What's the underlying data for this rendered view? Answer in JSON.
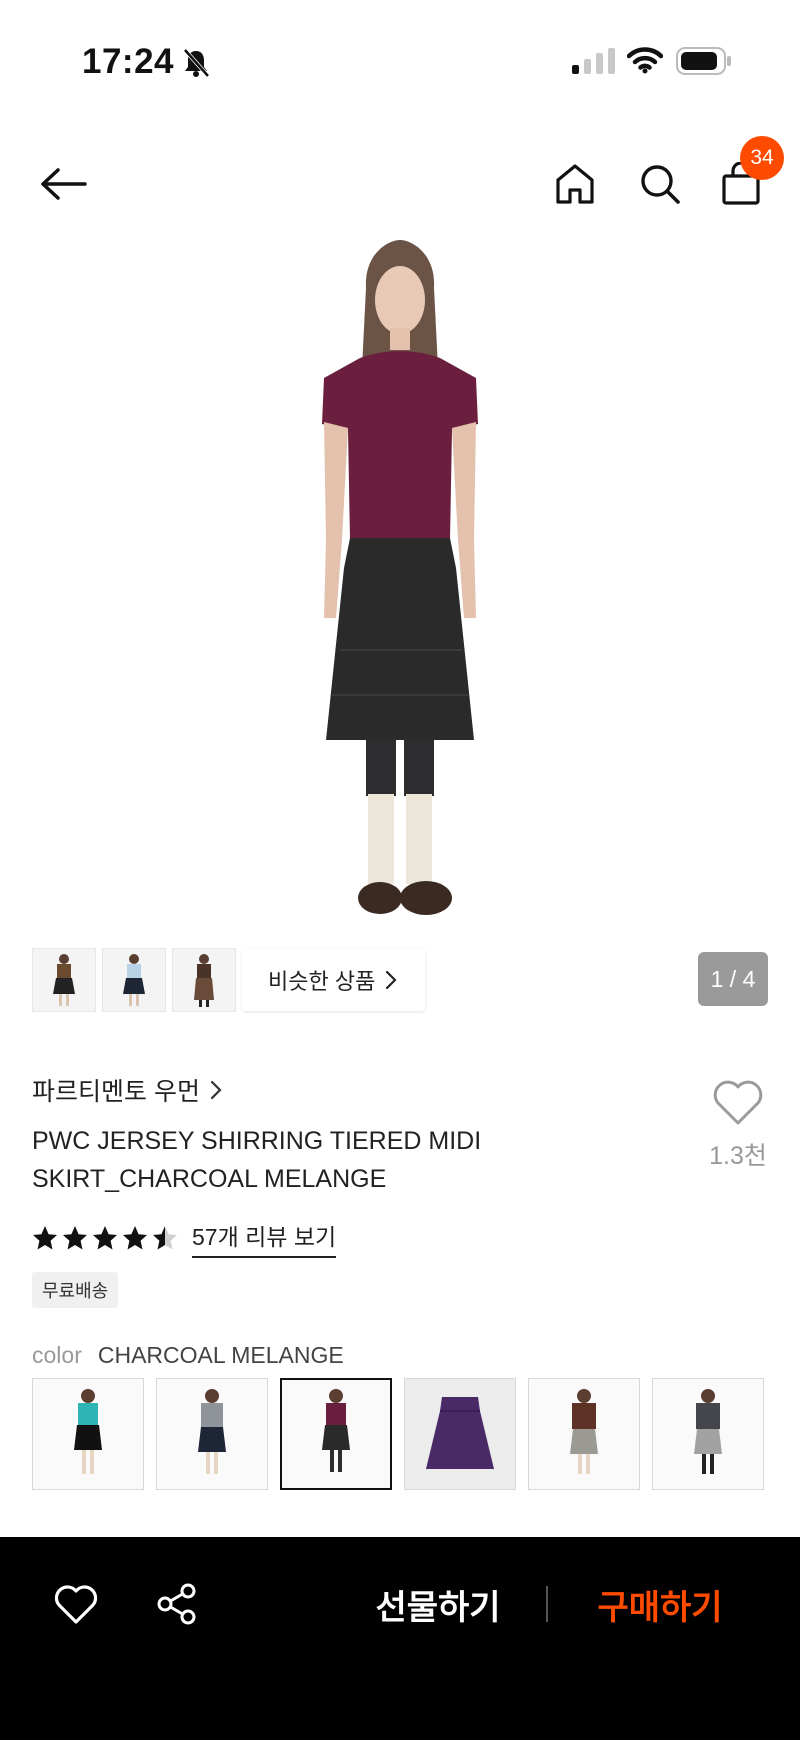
{
  "status": {
    "time": "17:24"
  },
  "nav": {
    "cart_count": "34"
  },
  "gallery": {
    "similar_label": "비슷한 상품",
    "page_indicator": "1 / 4"
  },
  "product": {
    "brand": "파르티멘토 우먼",
    "title": "PWC JERSEY SHIRRING TIERED MIDI SKIRT_CHARCOAL MELANGE",
    "wish_count": "1.3천",
    "rating": 4.5,
    "review_link": "57개 리뷰 보기",
    "shipping_tag": "무료배송",
    "color_label": "color",
    "color_value": "CHARCOAL MELANGE"
  },
  "colors": {
    "accent": "#ff4b00",
    "bottom_bar": "#000000"
  },
  "bottom_bar": {
    "gift_label": "선물하기",
    "buy_label": "구매하기"
  }
}
